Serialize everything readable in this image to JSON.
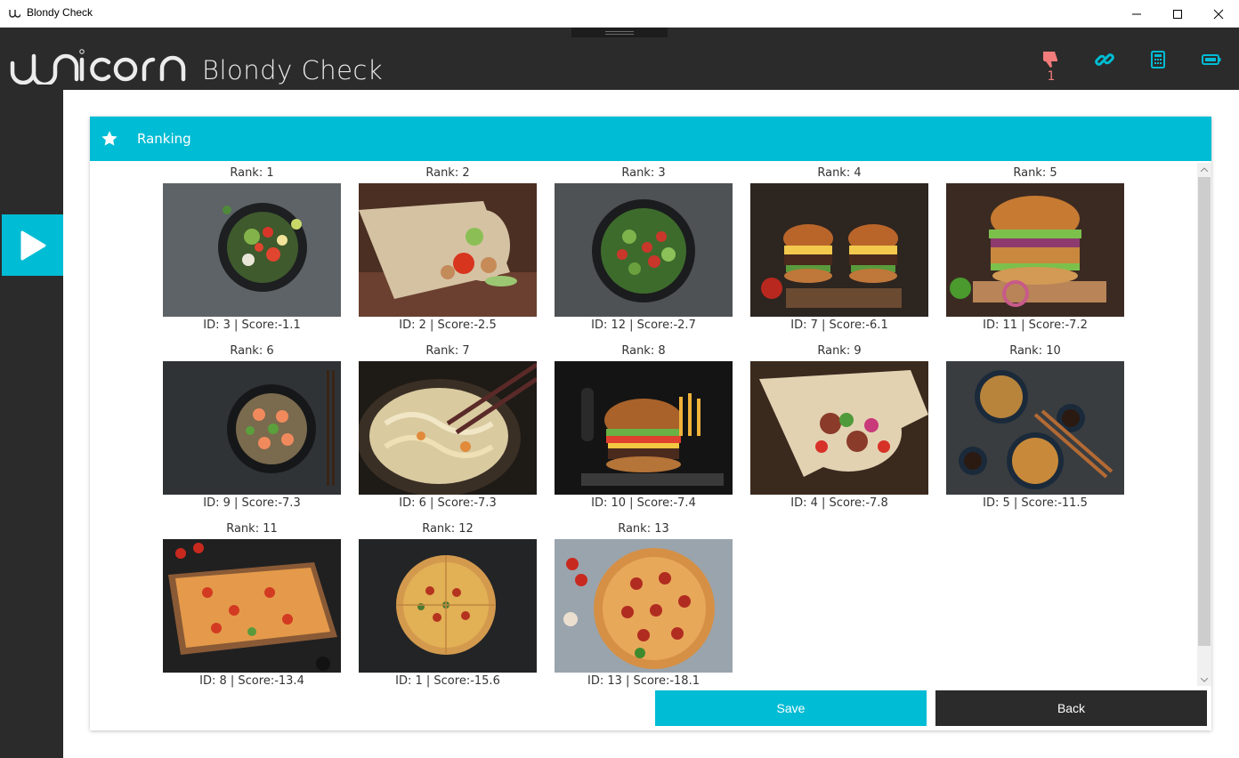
{
  "window": {
    "title": "Blondy Check",
    "controls": [
      "minimize",
      "maximize",
      "close"
    ]
  },
  "header": {
    "brand": "unicorn",
    "app_title": "Blondy Check",
    "icons": [
      {
        "name": "thumbs-down-icon",
        "count": "1",
        "color": "#f27b7b"
      },
      {
        "name": "link-icon",
        "color": "#00bcd4"
      },
      {
        "name": "calculator-icon",
        "color": "#00bcd4"
      },
      {
        "name": "battery-icon",
        "color": "#00bcd4"
      }
    ]
  },
  "sidebar": {
    "play_icon": "play-icon",
    "accent": "#00bcd4"
  },
  "ranking": {
    "title": "Ranking",
    "title_icon": "star-icon",
    "items": [
      {
        "rank": "Rank: 1",
        "caption": "ID: 3 | Score:-1.1",
        "image": "salad bowl"
      },
      {
        "rank": "Rank: 2",
        "caption": "ID: 2 | Score:-2.5",
        "image": "chicken wrap"
      },
      {
        "rank": "Rank: 3",
        "caption": "ID: 12 | Score:-2.7",
        "image": "salad plate"
      },
      {
        "rank": "Rank: 4",
        "caption": "ID: 7 | Score:-6.1",
        "image": "two burgers"
      },
      {
        "rank": "Rank: 5",
        "caption": "ID: 11 | Score:-7.2",
        "image": "chicken burger"
      },
      {
        "rank": "Rank: 6",
        "caption": "ID: 9 | Score:-7.3",
        "image": "shrimp noodles"
      },
      {
        "rank": "Rank: 7",
        "caption": "ID: 6 | Score:-7.3",
        "image": "noodles with chopsticks"
      },
      {
        "rank": "Rank: 8",
        "caption": "ID: 10 | Score:-7.4",
        "image": "burger with fries"
      },
      {
        "rank": "Rank: 9",
        "caption": "ID: 4 | Score:-7.8",
        "image": "kebab wrap"
      },
      {
        "rank": "Rank: 10",
        "caption": "ID: 5 | Score:-11.5",
        "image": "noodle bowls"
      },
      {
        "rank": "Rank: 11",
        "caption": "ID: 8 | Score:-13.4",
        "image": "flatbread pizza"
      },
      {
        "rank": "Rank: 12",
        "caption": "ID: 1 | Score:-15.6",
        "image": "pizza dark"
      },
      {
        "rank": "Rank: 13",
        "caption": "ID: 13 | Score:-18.1",
        "image": "pepperoni pizza"
      }
    ]
  },
  "actions": {
    "save_label": "Save",
    "back_label": "Back"
  }
}
